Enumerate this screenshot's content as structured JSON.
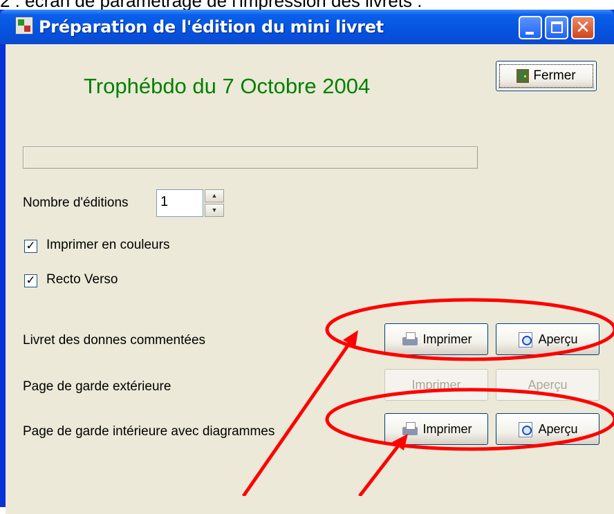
{
  "caption": "2 : écran de paramétrage de l'impression des livrets :",
  "window": {
    "title": "Préparation de l'édition du mini livret",
    "controls": {
      "minimize": "_",
      "maximize": "□",
      "close": "✕"
    }
  },
  "heading": "Trophébdo du 7 Octobre 2004",
  "close_button": {
    "label": "Fermer",
    "icon": "door-exit-icon"
  },
  "progress": {
    "value": 0
  },
  "editions": {
    "label": "Nombre d'éditions",
    "value": "1"
  },
  "options": {
    "color": {
      "label": "Imprimer en couleurs",
      "checked": true
    },
    "duplex": {
      "label": "Recto Verso",
      "checked": true
    }
  },
  "rows": [
    {
      "label": "Livret des donnes commentées",
      "print": "Imprimer",
      "preview": "Aperçu",
      "enabled": true
    },
    {
      "label": "Page de garde extérieure",
      "print": "Imprimer",
      "preview": "Aperçu",
      "enabled": false
    },
    {
      "label": "Page de garde intérieure avec diagrammes",
      "print": "Imprimer",
      "preview": "Aperçu",
      "enabled": true
    }
  ],
  "colors": {
    "titlebar": "#0553e0",
    "heading": "#008000",
    "annotation": "#ff0000",
    "client": "#ece9d8"
  },
  "icons": [
    "printer-icon",
    "magnify-icon",
    "door-exit-icon"
  ]
}
